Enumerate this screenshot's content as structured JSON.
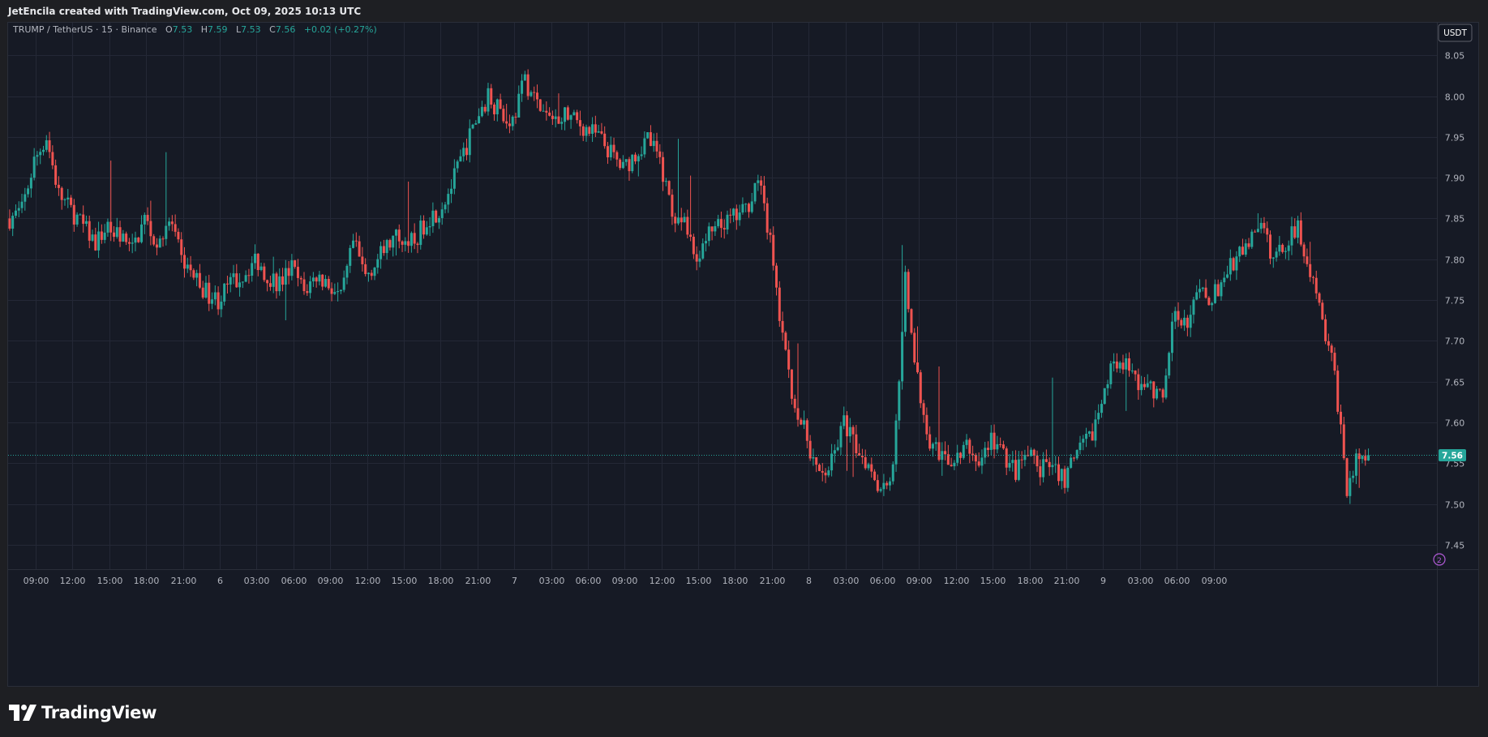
{
  "header": {
    "attribution": "JetEncila created with TradingView.com, Oct 09, 2025 10:13 UTC"
  },
  "legend": {
    "symbol": "TRUMP / TetherUS · 15 · Binance",
    "o_label": "O",
    "o_value": "7.53",
    "h_label": "H",
    "h_value": "7.59",
    "l_label": "L",
    "l_value": "7.53",
    "c_label": "C",
    "c_value": "7.56",
    "change": "+0.02 (+0.27%)"
  },
  "currency_button": "USDT",
  "last_price_label": "7.56",
  "footer": {
    "brand": "TradingView"
  },
  "colors": {
    "up": "#26a69a",
    "down": "#ef5350",
    "background": "#161a25",
    "grid": "#242836",
    "text": "#b2b5be"
  },
  "icons": [
    "tradingview-logo-icon",
    "compare-icon"
  ],
  "chart_data": {
    "type": "candlestick",
    "interval_minutes": 15,
    "ylim": [
      7.42,
      8.09
    ],
    "y_ticks": [
      "8.05",
      "8.00",
      "7.95",
      "7.90",
      "7.85",
      "7.80",
      "7.75",
      "7.70",
      "7.65",
      "7.60",
      "7.55",
      "7.50",
      "7.45"
    ],
    "x_ticks": [
      "09:00",
      "12:00",
      "15:00",
      "18:00",
      "21:00",
      "6",
      "03:00",
      "06:00",
      "09:00",
      "12:00",
      "15:00",
      "18:00",
      "21:00",
      "7",
      "03:00",
      "06:00",
      "09:00",
      "12:00",
      "15:00",
      "18:00",
      "21:00",
      "8",
      "03:00",
      "06:00",
      "09:00",
      "12:00",
      "15:00",
      "18:00",
      "21:00",
      "9",
      "03:00",
      "06:00",
      "09:00"
    ],
    "x_tick_start_hour": 9,
    "x_tick_step_hours": 3,
    "start_hour": 6.75,
    "last_close": 7.56,
    "close_path_hourly": [
      7.85,
      7.86,
      7.92,
      7.95,
      7.88,
      7.86,
      7.84,
      7.82,
      7.84,
      7.83,
      7.81,
      7.85,
      7.82,
      7.85,
      7.8,
      7.78,
      7.76,
      7.75,
      7.77,
      7.78,
      7.8,
      7.78,
      7.77,
      7.79,
      7.76,
      7.78,
      7.77,
      7.75,
      7.82,
      7.78,
      7.8,
      7.82,
      7.83,
      7.82,
      7.85,
      7.86,
      7.89,
      7.93,
      7.97,
      8.0,
      7.98,
      7.97,
      8.02,
      7.99,
      7.97,
      7.98,
      7.97,
      7.96,
      7.95,
      7.93,
      7.91,
      7.93,
      7.95,
      7.92,
      7.86,
      7.84,
      7.8,
      7.83,
      7.84,
      7.85,
      7.86,
      7.9,
      7.82,
      7.7,
      7.62,
      7.58,
      7.53,
      7.55,
      7.6,
      7.57,
      7.55,
      7.52,
      7.54,
      7.78,
      7.65,
      7.58,
      7.56,
      7.55,
      7.57,
      7.55,
      7.58,
      7.56,
      7.54,
      7.56,
      7.54,
      7.55,
      7.53,
      7.56,
      7.58,
      7.62,
      7.68,
      7.67,
      7.65,
      7.64,
      7.63,
      7.74,
      7.72,
      7.76,
      7.75,
      7.78,
      7.8,
      7.82,
      7.84,
      7.8,
      7.82,
      7.84,
      7.79,
      7.72,
      7.66,
      7.52,
      7.56
    ]
  }
}
